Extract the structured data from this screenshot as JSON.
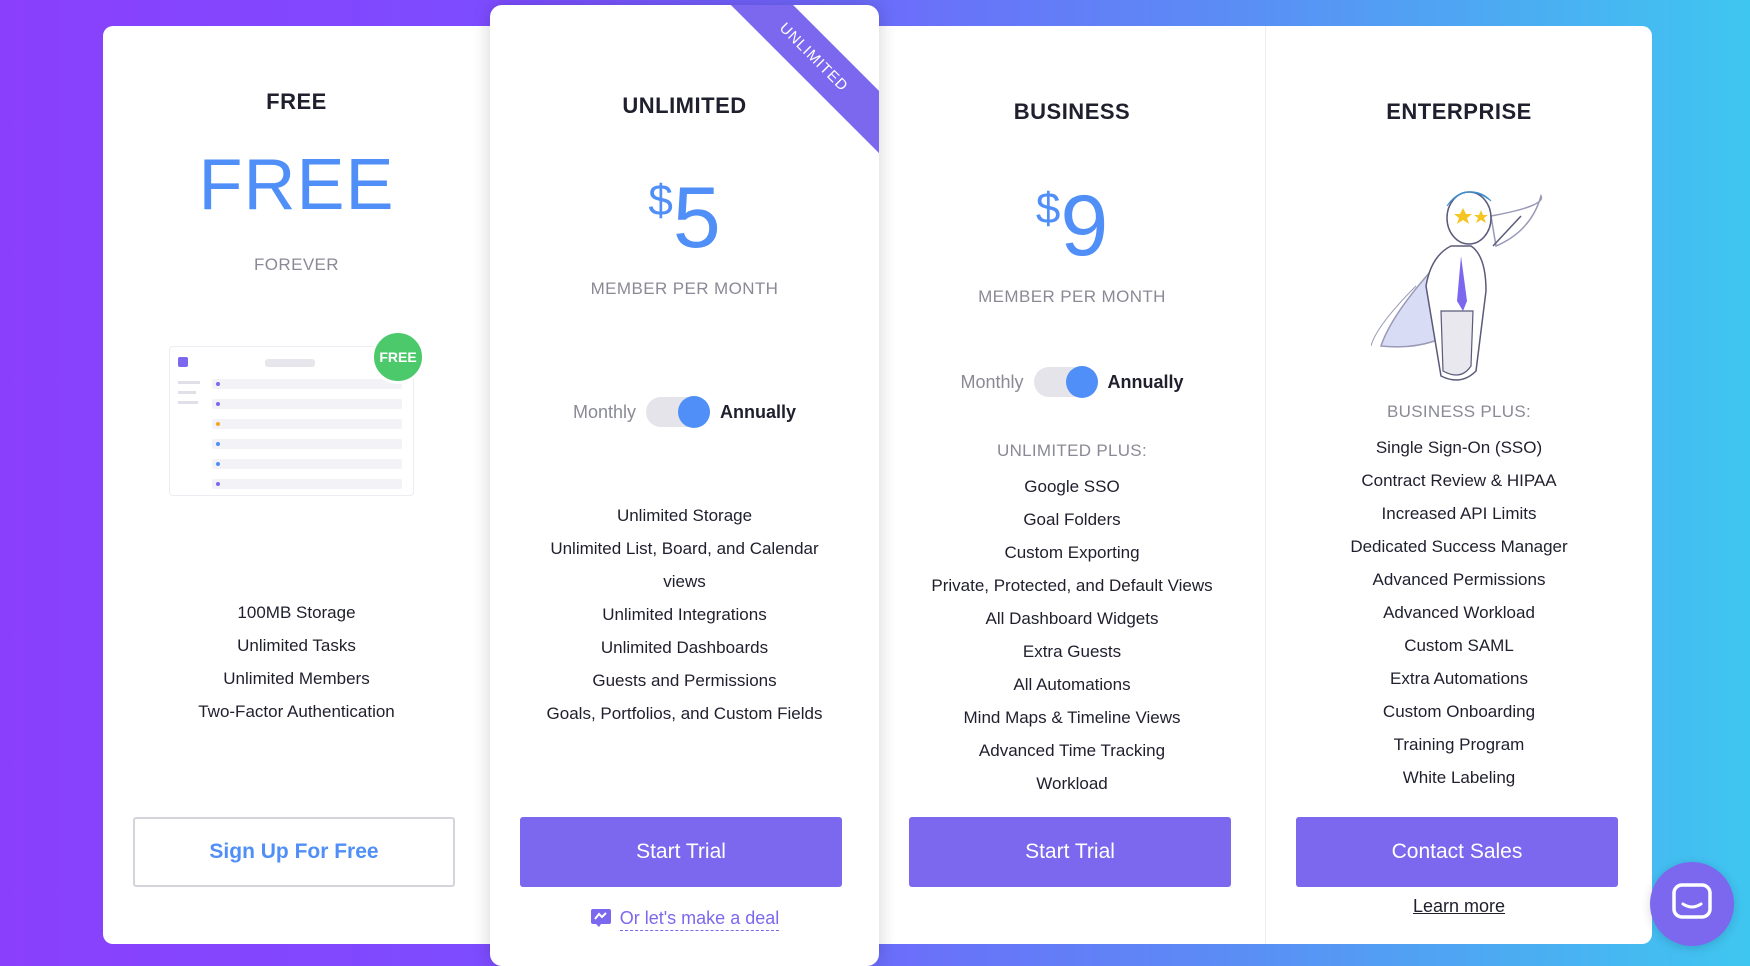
{
  "plans": {
    "free": {
      "title": "FREE",
      "price": "FREE",
      "period": "FOREVER",
      "badge": "FREE",
      "features": [
        "100MB Storage",
        "Unlimited Tasks",
        "Unlimited Members",
        "Two-Factor Authentication"
      ],
      "cta": "Sign Up For Free"
    },
    "unlimited": {
      "title": "UNLIMITED",
      "ribbon": "UNLIMITED",
      "currency": "$",
      "price": "5",
      "period": "MEMBER PER MONTH",
      "toggle_off": "Monthly",
      "toggle_on": "Annually",
      "features": [
        "Unlimited Storage",
        "Unlimited List, Board, and Calendar",
        "views",
        "Unlimited Integrations",
        "Unlimited Dashboards",
        "Guests and Permissions",
        "Goals, Portfolios, and Custom Fields"
      ],
      "cta": "Start Trial",
      "deal_link": "Or let's make a deal"
    },
    "business": {
      "title": "BUSINESS",
      "currency": "$",
      "price": "9",
      "period": "MEMBER PER MONTH",
      "toggle_off": "Monthly",
      "toggle_on": "Annually",
      "plus_label": "UNLIMITED PLUS:",
      "features": [
        "Google SSO",
        "Goal Folders",
        "Custom Exporting",
        "Private, Protected, and Default Views",
        "All Dashboard Widgets",
        "Extra Guests",
        "All Automations",
        "Mind Maps & Timeline Views",
        "Advanced Time Tracking",
        "Workload"
      ],
      "cta": "Start Trial"
    },
    "enterprise": {
      "title": "ENTERPRISE",
      "plus_label": "BUSINESS PLUS:",
      "features": [
        "Single Sign-On (SSO)",
        "Contract Review & HIPAA",
        "Increased API Limits",
        "Dedicated Success Manager",
        "Advanced Permissions",
        "Advanced Workload",
        "Custom SAML",
        "Extra Automations",
        "Custom Onboarding",
        "Training Program",
        "White Labeling"
      ],
      "cta": "Contact Sales",
      "learn_more": "Learn more"
    }
  },
  "colors": {
    "accent": "#7b68ee",
    "price_blue": "#4f8ff7",
    "badge_green": "#4cc96b"
  },
  "icons": {
    "chat": "chat-icon",
    "deal": "handshake-icon",
    "hero": "superhero-illustration"
  }
}
